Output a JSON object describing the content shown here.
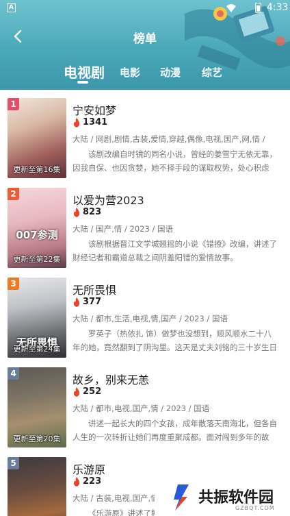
{
  "status": {
    "time": "4:33",
    "notif_letter": "A"
  },
  "header": {
    "title": "榜单",
    "back": "back"
  },
  "tabs": [
    {
      "label": "电视剧",
      "active": true
    },
    {
      "label": "电影",
      "active": false
    },
    {
      "label": "动漫",
      "active": false
    },
    {
      "label": "综艺",
      "active": false
    }
  ],
  "colors": {
    "header": "#4aa8b8",
    "rank1": "#e84a6e",
    "rank2": "#ef5a38",
    "rank3": "#f07a22",
    "rank_other": "#6b7d99",
    "heat": "#e8432b"
  },
  "items": [
    {
      "rank": "1",
      "title": "宁安如梦",
      "heat": "1341",
      "tags": "大陆 / 网剧,剧情,古装,爱情,穿越,偶像,电视,国产,网,情 /",
      "desc": "该剧改编自时镜的同名小说，曾经的姜雪宁无依无靠，因我自保、也因贪婪，她不择手段的谋取权势，处心积虑",
      "poster_caption": "更新至第16集",
      "poster_overlay": ""
    },
    {
      "rank": "2",
      "title": "以爱为营2023",
      "heat": "823",
      "tags": "大陆 / 国产,情 / 2023 / 国语",
      "desc": "该剧根据晋江文学城翘摇的小说《错撩》改编，讲述了财经记者和霸道总裁之间阴差阳错的爱情故事。",
      "poster_caption": "更新至第22集",
      "poster_overlay": "007参测"
    },
    {
      "rank": "3",
      "title": "无所畏惧",
      "heat": "377",
      "tags": "大陆 / 都市,生活,电视,情,国产 / 2023 / 国语",
      "desc": "罗英子（热依扎 饰）做梦也没想到，顺风顺水二十八年的她，竟然翻到了阴沟里。这天是丈夫刘铭的三十岁生日",
      "poster_caption": "更新至第24集",
      "poster_overlay": "无所畏惧"
    },
    {
      "rank": "4",
      "title": "故乡，别来无恙",
      "heat": "252",
      "tags": "大陆 / 都市,电视,国产,情 / 2023 / 国语",
      "desc": "讲述一起长大的四个女孩，成年散落天南海北，但各自人生的一次转折让她们再度重聚成都。面对闯到多年的故",
      "poster_caption": "更新至第20集",
      "poster_overlay": ""
    },
    {
      "rank": "5",
      "title": "乐游原",
      "heat": "223",
      "tags": "大陆 / 古装,电视,国产,情",
      "desc": "《乐游原》讲述了韩",
      "poster_caption": "",
      "poster_overlay": ""
    }
  ],
  "watermark": {
    "name": "共振软件园",
    "domain": "GZBQT.COM"
  }
}
